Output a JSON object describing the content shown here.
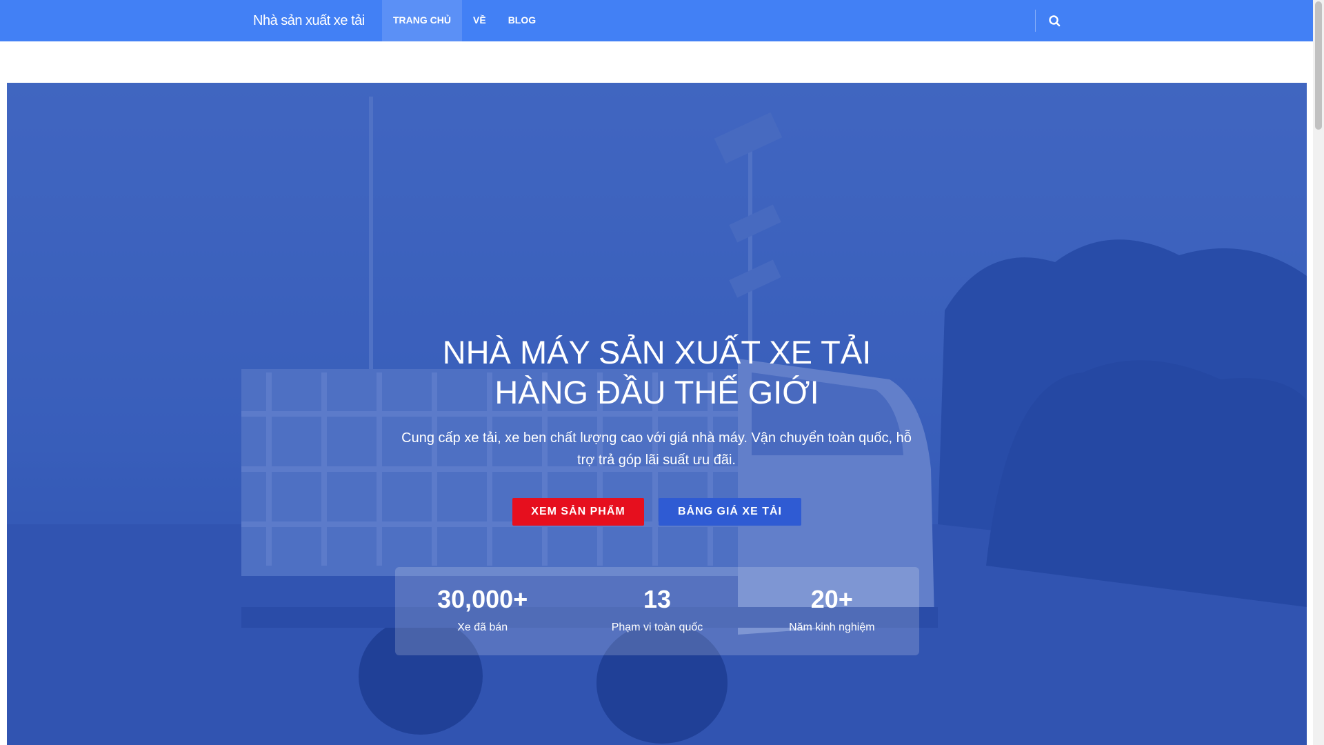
{
  "header": {
    "brand": "Nhà sản xuất xe tải",
    "nav": [
      {
        "label": "TRANG CHỦ",
        "active": true
      },
      {
        "label": "VỀ",
        "active": false
      },
      {
        "label": "BLOG",
        "active": false
      }
    ],
    "search_icon": "search-icon"
  },
  "hero": {
    "title_line1": "NHÀ MÁY SẢN XUẤT XE TẢI",
    "title_line2": "HÀNG ĐẦU THẾ GIỚI",
    "subtitle": "Cung cấp xe tải, xe ben chất lượng cao với giá nhà máy. Vận chuyển toàn quốc, hỗ trợ trả góp lãi suất ưu đãi.",
    "primary_button": "XEM SẢN PHẨM",
    "secondary_button": "BẢNG GIÁ XE TẢI",
    "stats": [
      {
        "value": "30,000+",
        "label": "Xe đã bán"
      },
      {
        "value": "13",
        "label": "Phạm vi toàn quốc"
      },
      {
        "value": "20+",
        "label": "Năm kinh nghiệm"
      }
    ]
  },
  "colors": {
    "header_bg": "#4280f5",
    "primary_button": "#e60f1e",
    "secondary_button": "#2f5bd3"
  }
}
